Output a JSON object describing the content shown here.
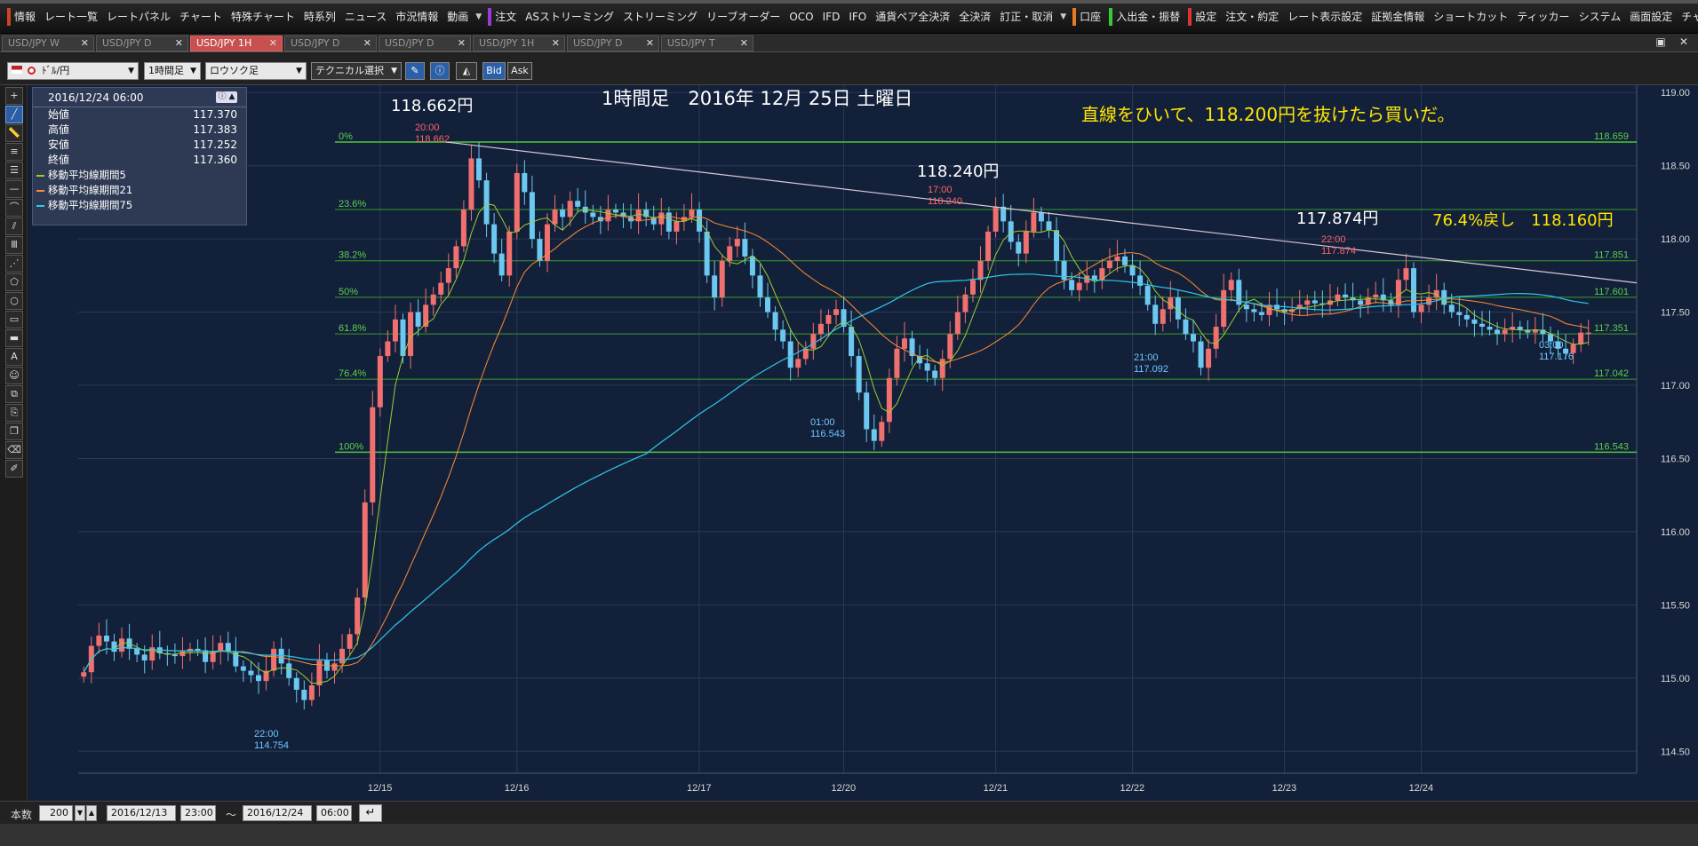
{
  "menu": {
    "items": [
      {
        "label": "情報",
        "sep": "sep-red"
      },
      {
        "label": "レート一覧",
        "sep": ""
      },
      {
        "label": "レートパネル",
        "sep": ""
      },
      {
        "label": "チャート",
        "sep": ""
      },
      {
        "label": "特殊チャート",
        "sep": ""
      },
      {
        "label": "時系列",
        "sep": ""
      },
      {
        "label": "ニュース",
        "sep": ""
      },
      {
        "label": "市況情報",
        "sep": ""
      },
      {
        "label": "動画",
        "sep": ""
      },
      {
        "label": "注文",
        "sep": "sep-purple"
      },
      {
        "label": "ASストリーミング",
        "sep": ""
      },
      {
        "label": "ストリーミング",
        "sep": ""
      },
      {
        "label": "リーブオーダー",
        "sep": ""
      },
      {
        "label": "OCO",
        "sep": ""
      },
      {
        "label": "IFD",
        "sep": ""
      },
      {
        "label": "IFO",
        "sep": ""
      },
      {
        "label": "通貨ペア全決済",
        "sep": ""
      },
      {
        "label": "全決済",
        "sep": ""
      },
      {
        "label": "訂正・取消",
        "sep": ""
      },
      {
        "label": "口座",
        "sep": "sep-orange"
      },
      {
        "label": "入出金・振替",
        "sep": "sep-green"
      },
      {
        "label": "設定",
        "sep": "sep-red2"
      },
      {
        "label": "注文・約定",
        "sep": ""
      },
      {
        "label": "レート表示設定",
        "sep": ""
      },
      {
        "label": "証拠金情報",
        "sep": ""
      },
      {
        "label": "ショートカット",
        "sep": ""
      },
      {
        "label": "ティッカー",
        "sep": ""
      },
      {
        "label": "システム",
        "sep": ""
      },
      {
        "label": "画面設定",
        "sep": ""
      },
      {
        "label": "チャート",
        "sep": ""
      }
    ]
  },
  "tabs": [
    {
      "label": "USD/JPY W",
      "active": false
    },
    {
      "label": "USD/JPY D",
      "active": false
    },
    {
      "label": "USD/JPY 1H",
      "active": true
    },
    {
      "label": "USD/JPY D",
      "active": false
    },
    {
      "label": "USD/JPY D",
      "active": false
    },
    {
      "label": "USD/JPY 1H",
      "active": false
    },
    {
      "label": "USD/JPY D",
      "active": false
    },
    {
      "label": "USD/JPY T",
      "active": false
    }
  ],
  "toolbar": {
    "pair": "ﾄﾞﾙ/円",
    "timeframe": "1時間足",
    "chart_type": "ロウソク足",
    "technical": "テクニカル選択",
    "bid": "Bid",
    "ask": "Ask"
  },
  "info_panel": {
    "datetime": "2016/12/24 06:00",
    "rows": [
      {
        "label": "始値",
        "value": "117.370"
      },
      {
        "label": "高値",
        "value": "117.383"
      },
      {
        "label": "安値",
        "value": "117.252"
      },
      {
        "label": "終値",
        "value": "117.360"
      }
    ],
    "ma": [
      {
        "label": "移動平均線期間5",
        "color": "#9acd32"
      },
      {
        "label": "移動平均線期間21",
        "color": "#ff8c32"
      },
      {
        "label": "移動平均線期間75",
        "color": "#2ec8e6"
      }
    ]
  },
  "bottom": {
    "count_label": "本数",
    "count_value": "200",
    "from_date": "2016/12/13",
    "from_time": "23:00",
    "tilde": "～",
    "to_date": "2016/12/24",
    "to_time": "06:00"
  },
  "chart_data": {
    "type": "candlestick",
    "title": "1時間足　2016年 12月 25日 土曜日",
    "ylim": [
      114.35,
      119.05
    ],
    "yticks": [
      "119.00",
      "118.50",
      "118.00",
      "117.50",
      "117.00",
      "116.50",
      "116.00",
      "115.50",
      "115.00",
      "114.50"
    ],
    "xticks": [
      "12/15",
      "12/16",
      "12/17",
      "12/20",
      "12/21",
      "12/22",
      "12/23",
      "12/24"
    ],
    "annotations": [
      {
        "text": "118.662円",
        "color": "#ffffff",
        "size": 18
      },
      {
        "text": "118.240円",
        "color": "#ffffff",
        "size": 18
      },
      {
        "text": "117.874円",
        "color": "#ffffff",
        "size": 18
      },
      {
        "text": "直線をひいて、118.200円を抜けたら買いだ。",
        "color": "#ffe600",
        "size": 20
      },
      {
        "text": "76.4%戻し　118.160円",
        "color": "#ffe600",
        "size": 18
      }
    ],
    "fib": [
      {
        "pct": "0%",
        "value": "118.659"
      },
      {
        "pct": "23.6%",
        "value": ""
      },
      {
        "pct": "38.2%",
        "value": "117.851"
      },
      {
        "pct": "50%",
        "value": "117.601"
      },
      {
        "pct": "61.8%",
        "value": "117.351"
      },
      {
        "pct": "76.4%",
        "value": "117.042"
      },
      {
        "pct": "100%",
        "value": "116.543"
      }
    ],
    "fib_levels": [
      118.662,
      118.201,
      117.851,
      117.601,
      117.351,
      117.042,
      116.543
    ],
    "point_labels": [
      {
        "time": "20:00",
        "price": "118.662",
        "color": "#ff6464"
      },
      {
        "time": "17:00",
        "price": "118.240",
        "color": "#ff6464"
      },
      {
        "time": "22:00",
        "price": "117.874",
        "color": "#ff6464"
      },
      {
        "time": "22:00",
        "price": "114.754",
        "color": "#6ec8ff"
      },
      {
        "time": "01:00",
        "price": "116.543",
        "color": "#6ec8ff"
      },
      {
        "time": "21:00",
        "price": "117.092",
        "color": "#6ec8ff"
      },
      {
        "time": "03:00",
        "price": "117.176",
        "color": "#6ec8ff"
      }
    ],
    "trendline": [
      118.662,
      117.7
    ],
    "closes": [
      115.04,
      115.22,
      115.29,
      115.25,
      115.18,
      115.27,
      115.2,
      115.16,
      115.12,
      115.21,
      115.17,
      115.16,
      115.15,
      115.18,
      115.2,
      115.19,
      115.11,
      115.18,
      115.24,
      115.18,
      115.08,
      115.05,
      115.02,
      114.98,
      115.05,
      115.2,
      115.1,
      115.0,
      114.92,
      114.85,
      114.95,
      115.12,
      115.05,
      115.1,
      115.2,
      115.3,
      115.55,
      116.2,
      116.85,
      117.2,
      117.3,
      117.45,
      117.2,
      117.5,
      117.4,
      117.55,
      117.62,
      117.7,
      117.8,
      117.95,
      118.2,
      118.55,
      118.4,
      118.1,
      117.9,
      117.75,
      118.05,
      118.45,
      118.32,
      118.0,
      117.85,
      118.1,
      118.2,
      118.15,
      118.26,
      118.22,
      118.18,
      118.15,
      118.12,
      118.2,
      118.18,
      118.15,
      118.12,
      118.2,
      118.15,
      118.1,
      118.18,
      118.05,
      118.12,
      118.15,
      118.2,
      118.05,
      117.75,
      117.6,
      117.85,
      117.95,
      118.0,
      117.88,
      117.75,
      117.6,
      117.5,
      117.38,
      117.3,
      117.12,
      117.18,
      117.25,
      117.35,
      117.42,
      117.48,
      117.52,
      117.4,
      117.2,
      116.95,
      116.7,
      116.62,
      116.75,
      117.05,
      117.25,
      117.32,
      117.2,
      117.15,
      117.1,
      117.05,
      117.18,
      117.35,
      117.5,
      117.62,
      117.72,
      117.85,
      118.05,
      118.22,
      118.12,
      117.98,
      117.9,
      118.05,
      118.18,
      118.12,
      118.06,
      117.85,
      117.72,
      117.65,
      117.7,
      117.75,
      117.72,
      117.8,
      117.85,
      117.88,
      117.82,
      117.75,
      117.68,
      117.55,
      117.42,
      117.52,
      117.6,
      117.45,
      117.35,
      117.3,
      117.12,
      117.25,
      117.4,
      117.65,
      117.72,
      117.55,
      117.52,
      117.5,
      117.48,
      117.55,
      117.52,
      117.5,
      117.52,
      117.55,
      117.58,
      117.56,
      117.55,
      117.58,
      117.62,
      117.6,
      117.58,
      117.55,
      117.6,
      117.62,
      117.58,
      117.55,
      117.72,
      117.8,
      117.5,
      117.55,
      117.6,
      117.65,
      117.55,
      117.5,
      117.48,
      117.45,
      117.42,
      117.4,
      117.38,
      117.35,
      117.38,
      117.4,
      117.38,
      117.36,
      117.38,
      117.35,
      117.3,
      117.25,
      117.22,
      117.28,
      117.36,
      117.36
    ]
  }
}
